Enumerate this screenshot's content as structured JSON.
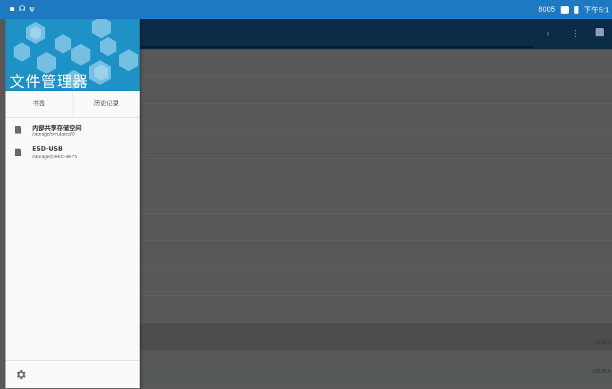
{
  "status_bar": {
    "left_icons": [
      "sd-card-icon",
      "usb-icon",
      "usb-tether-icon"
    ],
    "right_text": "8005",
    "time": "下午5:1"
  },
  "drawer": {
    "title": "文件管理器",
    "tabs": [
      {
        "label": "书签"
      },
      {
        "label": "历史记录"
      }
    ],
    "storage": [
      {
        "title": "内部共享存储空间",
        "path": "/storage/emulated/0"
      },
      {
        "title": "ESD-USB",
        "path": "/storage/CEEC-9E75"
      }
    ],
    "footer_icon": "gear-icon"
  },
  "background": {
    "toolbar_icons": [
      "chevron-right-icon",
      "more-vert-icon",
      "search-icon"
    ],
    "sizes": [
      "45.09 k",
      "156.35 k"
    ]
  },
  "colors": {
    "status_bar": "#1f79c2",
    "drawer_header": "#1e92c7",
    "toolbar": "#0c2b47"
  }
}
